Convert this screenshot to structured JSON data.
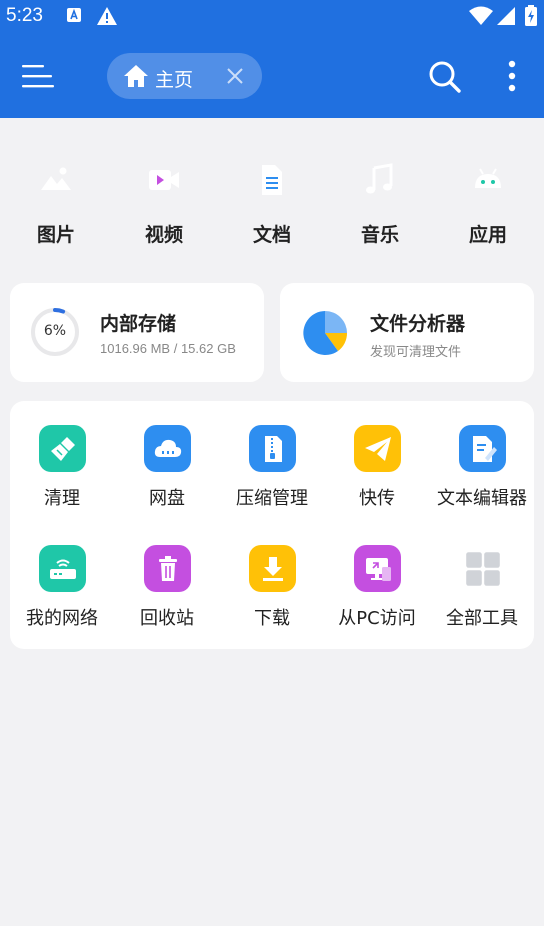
{
  "status_bar": {
    "time": "5:23",
    "icons": [
      "keyboard-a-icon",
      "warning-icon",
      "wifi-icon",
      "signal-icon",
      "battery-icon"
    ]
  },
  "app_bar": {
    "background": "#2070e0",
    "tab": {
      "label": "主页"
    },
    "icons": [
      "menu-icon",
      "home-icon",
      "close-icon",
      "search-icon",
      "more-vert-icon"
    ]
  },
  "categories": [
    {
      "label": "图片",
      "icon": "image-icon",
      "color": "#ffc107"
    },
    {
      "label": "视频",
      "icon": "video-icon",
      "color": "#c44fe0"
    },
    {
      "label": "文档",
      "icon": "document-icon",
      "color": "#2e8ef0"
    },
    {
      "label": "音乐",
      "icon": "music-icon",
      "color": "#f04a6a"
    },
    {
      "label": "应用",
      "icon": "android-icon",
      "color": "#1fc7a8"
    }
  ],
  "storage": {
    "title": "内部存储",
    "percent_label": "6%",
    "used_fraction": 0.06,
    "detail": "1016.96 MB / 15.62 GB"
  },
  "analyzer": {
    "title": "文件分析器",
    "subtitle": "发现可清理文件"
  },
  "tools": [
    {
      "label": "清理",
      "icon": "broom-icon",
      "color": "#1fc7a8"
    },
    {
      "label": "网盘",
      "icon": "cloud-icon",
      "color": "#2e8ef0"
    },
    {
      "label": "压缩管理",
      "icon": "zip-icon",
      "color": "#2e8ef0"
    },
    {
      "label": "快传",
      "icon": "send-icon",
      "color": "#ffc107"
    },
    {
      "label": "文本编辑器",
      "icon": "text-editor-icon",
      "color": "#2e8ef0"
    },
    {
      "label": "我的网络",
      "icon": "router-icon",
      "color": "#1fc7a8"
    },
    {
      "label": "回收站",
      "icon": "trash-icon",
      "color": "#c44fe0"
    },
    {
      "label": "下载",
      "icon": "download-icon",
      "color": "#ffc107"
    },
    {
      "label": "从PC访问",
      "icon": "pc-access-icon",
      "color": "#c44fe0"
    },
    {
      "label": "全部工具",
      "icon": "grid-icon",
      "color": "#d0d3d8"
    }
  ]
}
